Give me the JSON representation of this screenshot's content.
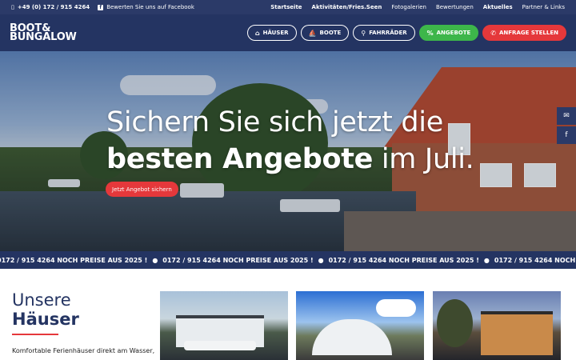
{
  "topbar": {
    "phone": "+49 (0) 172 / 915 4264",
    "facebook": "Bewerten Sie uns auf Facebook",
    "links": [
      {
        "label": "Startseite",
        "bold": true
      },
      {
        "label": "Aktivitäten/Fries.Seen",
        "bold": true
      },
      {
        "label": "Fotogalerien",
        "bold": false
      },
      {
        "label": "Bewertungen",
        "bold": false
      },
      {
        "label": "Aktuelles",
        "bold": true
      },
      {
        "label": "Partner & Links",
        "bold": false
      }
    ]
  },
  "logo": {
    "line1": "BOOT&",
    "line2": "BUNGALOW"
  },
  "nav": [
    {
      "label": "HÄUSER",
      "icon": "home-icon"
    },
    {
      "label": "BOOTE",
      "icon": "boat-icon"
    },
    {
      "label": "FAHRRÄDER",
      "icon": "bicycle-icon"
    },
    {
      "label": "ANGEBOTE",
      "icon": "percent-icon"
    },
    {
      "label": "ANFRAGE STELLEN",
      "icon": "phone-icon"
    }
  ],
  "hero": {
    "line1": "Sichern Sie sich jetzt die",
    "bold": "besten Angebote",
    "rest": " im Juli.",
    "cta": "Jetzt Angebot sichern"
  },
  "ticker": {
    "text": "0172 / 915 4264 NOCH PREISE AUS 2025 !"
  },
  "section": {
    "title_light": "Unsere",
    "title_bold": "Häuser",
    "text": "Komfortable Ferienhäuser direkt am Wasser,"
  },
  "colors": {
    "navy": "#243462",
    "red": "#e5383b",
    "green": "#3db64a"
  }
}
